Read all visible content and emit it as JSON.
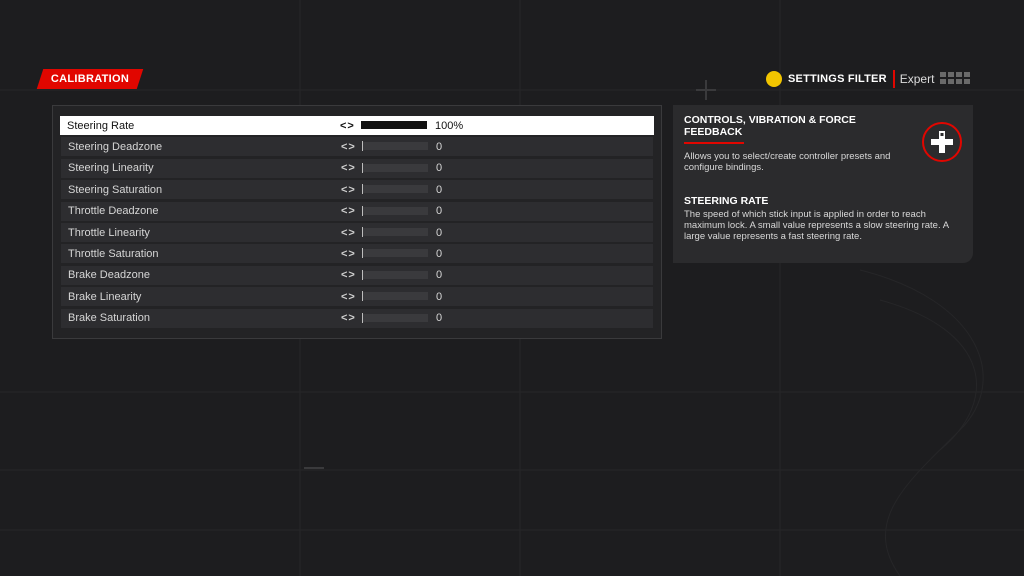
{
  "header": {
    "badge": "CALIBRATION",
    "filter_label": "SETTINGS FILTER",
    "filter_value": "Expert"
  },
  "list": {
    "rows": [
      {
        "label": "Steering Rate",
        "value": "100%",
        "level": 1.0,
        "selected": true
      },
      {
        "label": "Steering Deadzone",
        "value": "0",
        "level": 0,
        "selected": false
      },
      {
        "label": "Steering Linearity",
        "value": "0",
        "level": 0,
        "selected": false
      },
      {
        "label": "Steering Saturation",
        "value": "0",
        "level": 0,
        "selected": false
      },
      {
        "label": "Throttle Deadzone",
        "value": "0",
        "level": 0,
        "selected": false
      },
      {
        "label": "Throttle Linearity",
        "value": "0",
        "level": 0,
        "selected": false
      },
      {
        "label": "Throttle Saturation",
        "value": "0",
        "level": 0,
        "selected": false
      },
      {
        "label": "Brake Deadzone",
        "value": "0",
        "level": 0,
        "selected": false
      },
      {
        "label": "Brake Linearity",
        "value": "0",
        "level": 0,
        "selected": false
      },
      {
        "label": "Brake Saturation",
        "value": "0",
        "level": 0,
        "selected": false
      }
    ],
    "arrows": "<>"
  },
  "info": {
    "section_title": "CONTROLS, VIBRATION & FORCE FEEDBACK",
    "section_desc": "Allows you to select/create controller presets and configure bindings.",
    "item_title": "STEERING RATE",
    "item_desc": "The speed of which stick input is applied in order to reach maximum lock. A small value represents a slow steering rate. A large value represents a fast steering rate.",
    "icon": "dpad-icon"
  },
  "colors": {
    "accent": "#e10600",
    "filter_button": "#f2c500",
    "background": "#1d1d1f"
  }
}
